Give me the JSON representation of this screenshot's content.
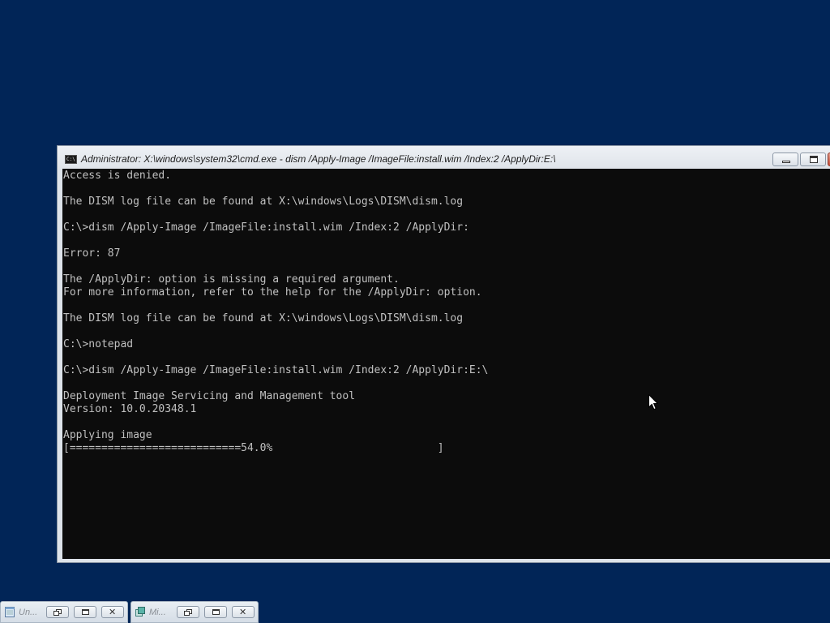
{
  "window": {
    "title": "Administrator: X:\\windows\\system32\\cmd.exe - dism  /Apply-Image /ImageFile:install.wim /Index:2 /ApplyDir:E:\\",
    "icon_label": "C:\\",
    "icons": {
      "app": "console-icon",
      "minimize": "minimize-icon",
      "maximize": "maximize-icon",
      "close": "close-icon"
    }
  },
  "console": {
    "lines": [
      "Access is denied.",
      "",
      "The DISM log file can be found at X:\\windows\\Logs\\DISM\\dism.log",
      "",
      "C:\\>dism /Apply-Image /ImageFile:install.wim /Index:2 /ApplyDir:",
      "",
      "Error: 87",
      "",
      "The /ApplyDir: option is missing a required argument.",
      "For more information, refer to the help for the /ApplyDir: option.",
      "",
      "The DISM log file can be found at X:\\windows\\Logs\\DISM\\dism.log",
      "",
      "C:\\>notepad",
      "",
      "C:\\>dism /Apply-Image /ImageFile:install.wim /Index:2 /ApplyDir:E:\\",
      "",
      "Deployment Image Servicing and Management tool",
      "Version: 10.0.20348.1",
      "",
      "Applying image",
      "[===========================54.0%                          ]"
    ],
    "progress_percent": 54.0
  },
  "cursor": {
    "icon": "mouse-pointer-icon"
  },
  "minimized_windows": [
    {
      "label": "Un...",
      "icon": "notepad-icon"
    },
    {
      "label": "Mi...",
      "icon": "management-console-icon"
    }
  ],
  "colors": {
    "desktop": "#012557",
    "console_bg": "#0c0c0c",
    "console_fg": "#c0c0c0",
    "close_button": "#c8503a"
  }
}
